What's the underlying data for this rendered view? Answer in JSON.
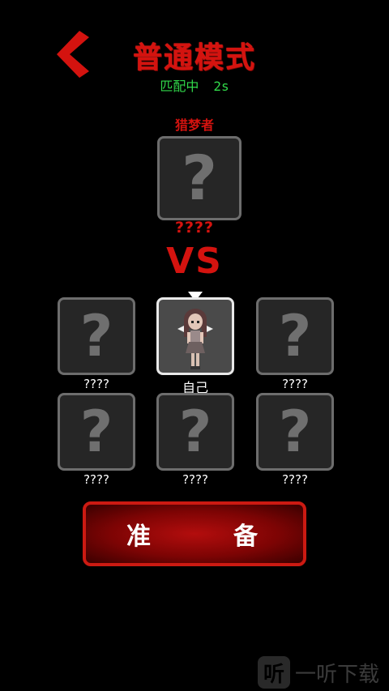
{
  "header": {
    "back_icon": "chevron-left-icon",
    "title": "普通模式",
    "status_text": "匹配中",
    "status_time": "2s"
  },
  "hunter": {
    "role_label": "猎梦者",
    "name": "????"
  },
  "vs_label": "VS",
  "players": [
    {
      "name": "????",
      "is_self": false
    },
    {
      "name": "自己",
      "is_self": true
    },
    {
      "name": "????",
      "is_self": false
    },
    {
      "name": "????",
      "is_self": false
    },
    {
      "name": "????",
      "is_self": false
    },
    {
      "name": "????",
      "is_self": false
    }
  ],
  "unknown_glyph": "?",
  "ready_button": {
    "left": "准",
    "right": "备"
  },
  "watermark": {
    "icon": "听",
    "text": "一听下载"
  },
  "colors": {
    "accent_red": "#d4130f",
    "status_green": "#31d84a",
    "slot_bg": "#262626"
  }
}
